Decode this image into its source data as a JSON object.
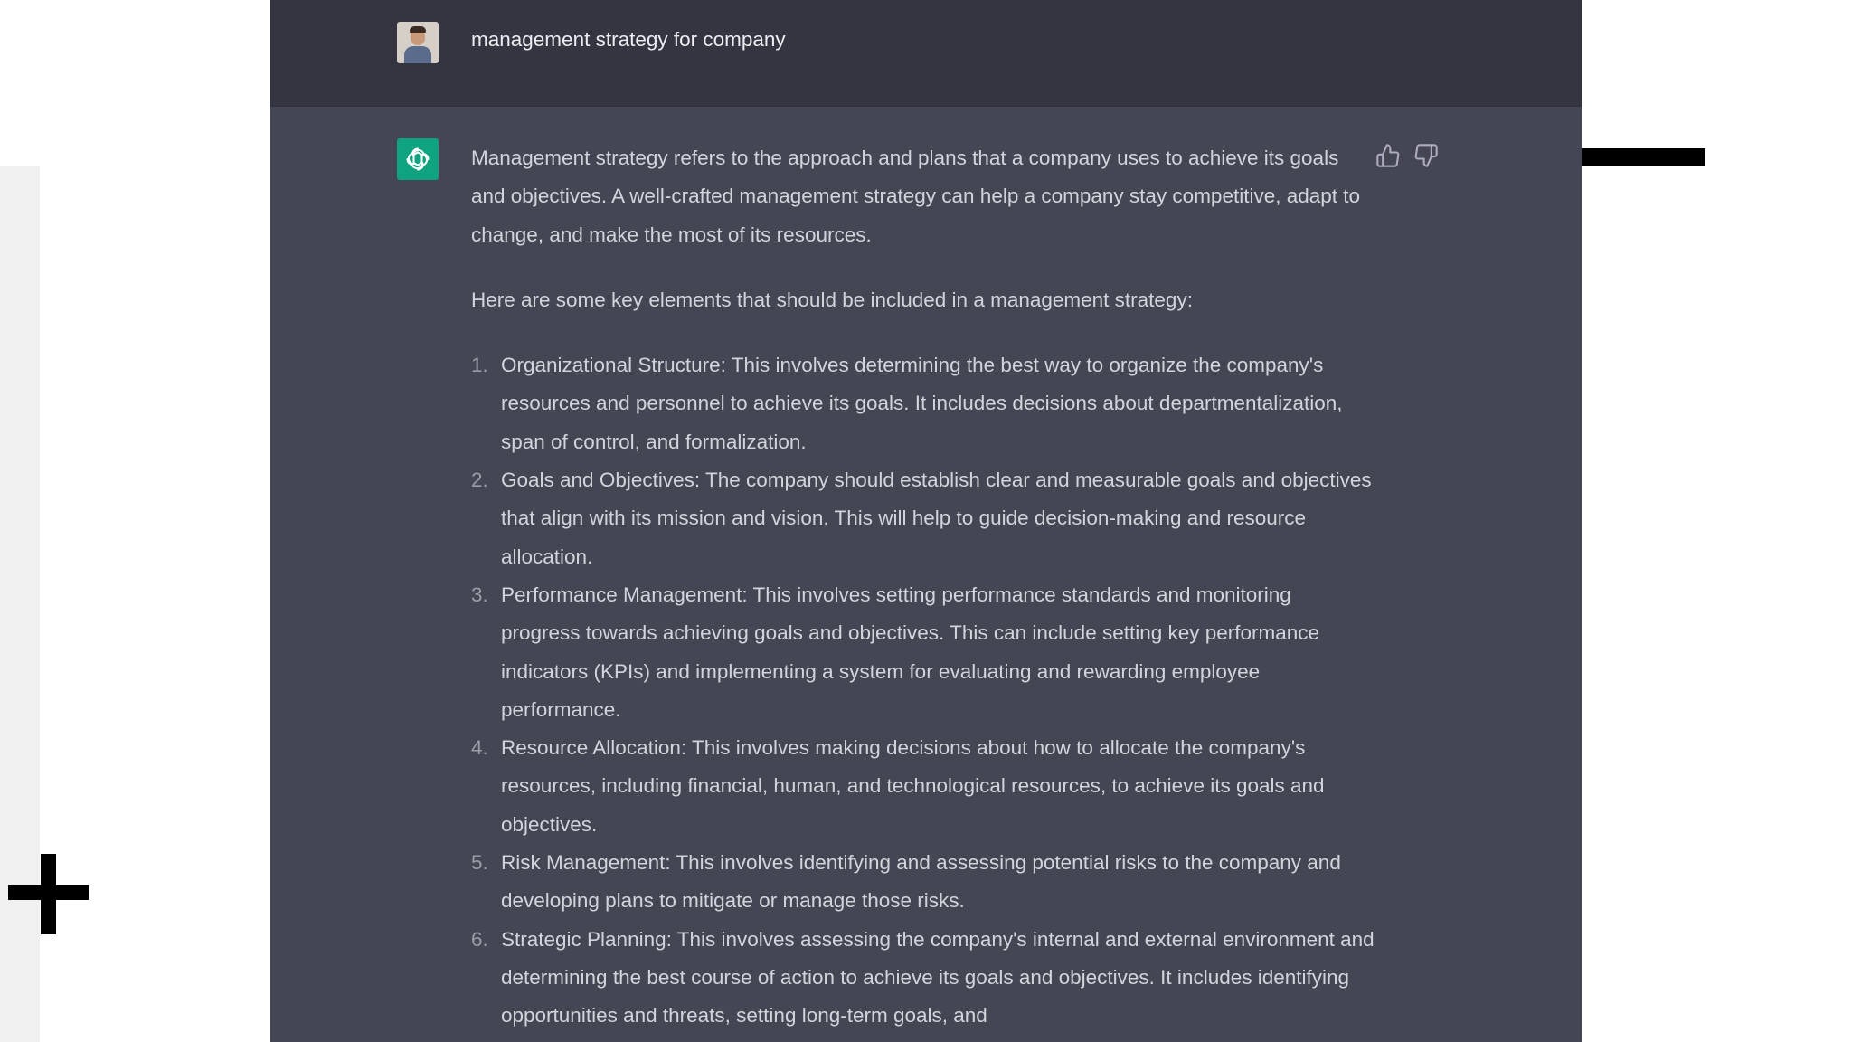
{
  "user_message": "management strategy for company",
  "response": {
    "intro": "Management strategy refers to the approach and plans that a company uses to achieve its goals and objectives. A well-crafted management strategy can help a company stay competitive, adapt to change, and make the most of its resources.",
    "lead_in": "Here are some key elements that should be included in a management strategy:",
    "items": [
      {
        "num": "1.",
        "text": "Organizational Structure: This involves determining the best way to organize the company's resources and personnel to achieve its goals. It includes decisions about departmentalization, span of control, and formalization."
      },
      {
        "num": "2.",
        "text": "Goals and Objectives: The company should establish clear and measurable goals and objectives that align with its mission and vision. This will help to guide decision-making and resource allocation."
      },
      {
        "num": "3.",
        "text": "Performance Management: This involves setting performance standards and monitoring progress towards achieving goals and objectives. This can include setting key performance indicators (KPIs) and implementing a system for evaluating and rewarding employee performance."
      },
      {
        "num": "4.",
        "text": "Resource Allocation: This involves making decisions about how to allocate the company's resources, including financial, human, and technological resources, to achieve its goals and objectives."
      },
      {
        "num": "5.",
        "text": "Risk Management: This involves identifying and assessing potential risks to the company and developing plans to mitigate or manage those risks."
      },
      {
        "num": "6.",
        "text": "Strategic Planning: This involves assessing the company's internal and external environment and determining the best course of action to achieve its goals and objectives. It includes identifying opportunities and threats, setting long-term goals, and"
      }
    ]
  },
  "icons": {
    "user_avatar": "user-avatar-photo",
    "assistant_avatar": "openai-logo-icon",
    "thumbs_up": "thumbs-up-icon",
    "thumbs_down": "thumbs-down-icon",
    "overlay_plus": "plus-icon"
  },
  "colors": {
    "user_row_bg": "#343541",
    "assistant_row_bg": "#444654",
    "assistant_avatar_bg": "#10a37f",
    "text": "#d1d5db"
  }
}
